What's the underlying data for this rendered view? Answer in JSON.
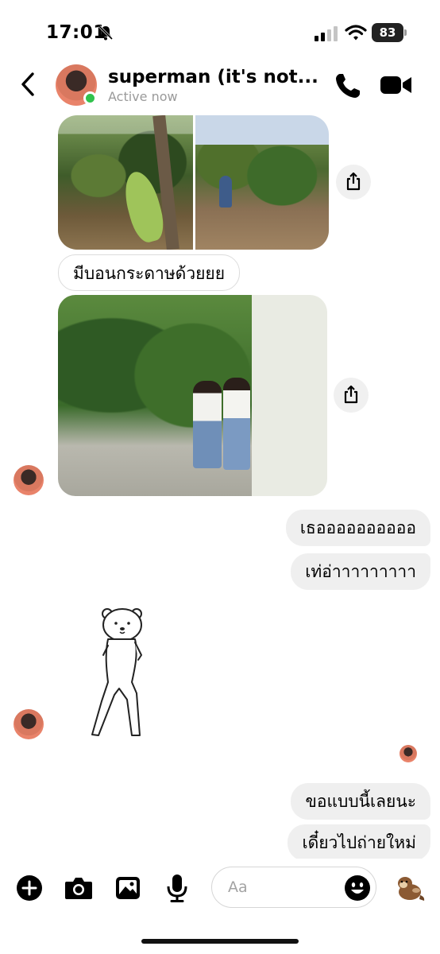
{
  "status_bar": {
    "time": "17:01",
    "battery": "83"
  },
  "header": {
    "contact_name": "superman (it's not...",
    "contact_status": "Active now"
  },
  "messages": {
    "incoming_1": "มีบอนกระดาษด้วยยย",
    "outgoing_1": "เธออออออออออ",
    "outgoing_2": "เท่อ่าาาาาาาาา",
    "outgoing_3": "ขอแบบนี้เลยนะ",
    "outgoing_4": "เดี๋ยวไปถ่ายใหม่"
  },
  "composer": {
    "placeholder": "Aa"
  },
  "colors": {
    "online": "#31c24d",
    "bubble_outgoing": "#efefef"
  }
}
